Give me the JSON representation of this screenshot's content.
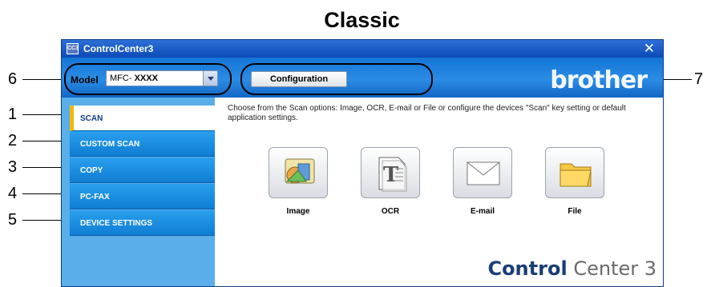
{
  "figure_title": "Classic",
  "callouts": [
    "1",
    "2",
    "3",
    "4",
    "5",
    "6",
    "7"
  ],
  "window": {
    "title": "ControlCenter3",
    "icon_text": "CC3",
    "close_glyph": "✕"
  },
  "topbar": {
    "model_label": "Model",
    "model_prefix": "MFC-",
    "model_value": "XXXX",
    "config_button": "Configuration",
    "brand": "brother"
  },
  "sidebar": {
    "items": [
      {
        "label": "SCAN",
        "active": true
      },
      {
        "label": "CUSTOM SCAN",
        "active": false
      },
      {
        "label": "COPY",
        "active": false
      },
      {
        "label": "PC-FAX",
        "active": false
      },
      {
        "label": "DEVICE SETTINGS",
        "active": false
      }
    ]
  },
  "content": {
    "description": "Choose from the Scan options: Image, OCR, E-mail or File or configure the devices \"Scan\" key setting or default application settings.",
    "tools": [
      {
        "label": "Image",
        "icon": "image-icon"
      },
      {
        "label": "OCR",
        "icon": "ocr-icon"
      },
      {
        "label": "E-mail",
        "icon": "email-icon"
      },
      {
        "label": "File",
        "icon": "folder-icon"
      }
    ],
    "logo_bold": "Control",
    "logo_light": "Center 3"
  },
  "colors": {
    "titlebar": "#0b4bb8",
    "topbar": "#1575d6",
    "sidebar_item": "#1d8fe3",
    "active_marker": "#f5b800"
  }
}
